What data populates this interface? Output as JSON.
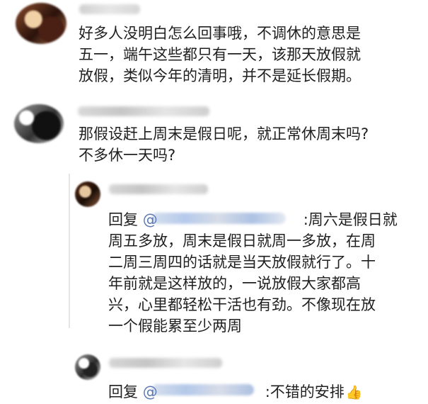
{
  "comment_main": {
    "text": "好多人没明白怎么回事哦，不调休的意思是\n五一，端午这些都只有一天，该那天放假就\n放假，类似今年的清明，并不是延长假期。"
  },
  "comment_sub": {
    "text": "那假设赶上周末是假日呢，就正常休周末吗?\n不多休一天吗?"
  },
  "reply_1": {
    "prefix": "回复",
    "at": "@",
    "text_after_mention": ":周六是假日就\n周五多放，周末是假日就周一多放，在周\n二周三周四的话就是当天放假就行了。十\n年前就是这样放的，一说放假大家都高\n兴，心里都轻松干活也有劲。不像现在放\n一个假能累至少两周"
  },
  "reply_2": {
    "prefix": "回复",
    "at": "@",
    "text_after_mention": ":不错的安排",
    "emoji": "👍"
  },
  "colors": {
    "mention": "#5b79b4",
    "text": "#1f1f1f",
    "thread_line": "#e5e5e5"
  }
}
